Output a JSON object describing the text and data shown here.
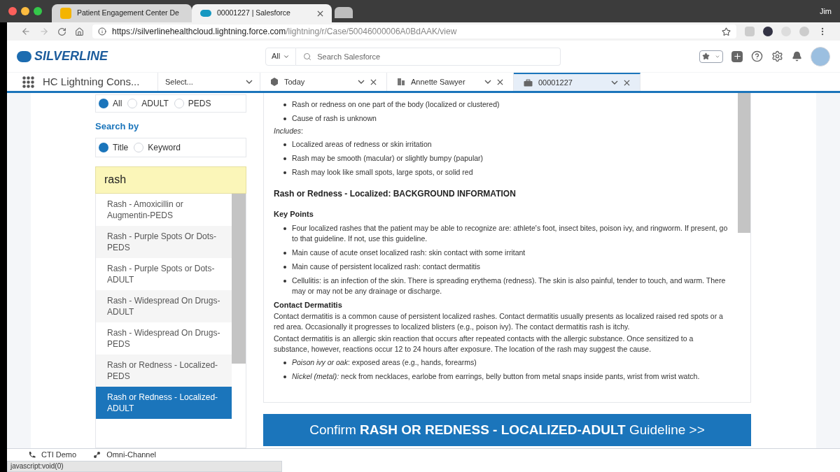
{
  "browser": {
    "tabs": [
      {
        "title": "Patient Engagement Center De",
        "kind": "doc",
        "selected": false
      },
      {
        "title": "00001227 | Salesforce",
        "kind": "cloud",
        "selected": true
      },
      {
        "kind": "new",
        "selected": false
      }
    ],
    "url_host": "https://silverlinehealthcloud.lightning.force.com",
    "url_path": "/lightning/r/Case/50046000006A0BdAAK/view",
    "user": "Jim"
  },
  "header": {
    "logo": "SILVERLINE",
    "search_scope": "All",
    "search_placeholder": "Search Salesforce"
  },
  "nav": {
    "app_name": "HC Lightning Cons...",
    "select_placeholder": "Select...",
    "tabs": [
      {
        "label": "Today",
        "kind": "hexagon",
        "selected": false
      },
      {
        "label": "Annette Sawyer",
        "kind": "building",
        "selected": false
      },
      {
        "label": "00001227",
        "kind": "briefcase",
        "selected": true
      }
    ]
  },
  "filters": {
    "population": [
      {
        "label": "All",
        "selected": true
      },
      {
        "label": "ADULT",
        "selected": false
      },
      {
        "label": "PEDS",
        "selected": false
      }
    ],
    "search_by_label": "Search by",
    "search_by": [
      {
        "label": "Title",
        "selected": true
      },
      {
        "label": "Keyword",
        "selected": false
      }
    ],
    "query": "rash",
    "results": [
      {
        "title": "Rash - Amoxicillin or Augmentin-PEDS",
        "selected": false
      },
      {
        "title": "Rash - Purple Spots Or Dots-PEDS",
        "selected": false
      },
      {
        "title": "Rash - Purple Spots or Dots-ADULT",
        "selected": false
      },
      {
        "title": "Rash - Widespread On Drugs-ADULT",
        "selected": false
      },
      {
        "title": "Rash - Widespread On Drugs-PEDS",
        "selected": false
      },
      {
        "title": "Rash or Redness - Localized-PEDS",
        "selected": false
      },
      {
        "title": "Rash or Redness - Localized-ADULT",
        "selected": true
      }
    ]
  },
  "article": [
    {
      "kind": "bullet",
      "text": "Rash or redness on one part of the body (localized or clustered)"
    },
    {
      "kind": "bullet",
      "text": "Cause of rash is unknown"
    },
    {
      "kind": "paragraph",
      "text": "*Includes*:"
    },
    {
      "kind": "bullet",
      "text": "Localized areas of redness or skin irritation"
    },
    {
      "kind": "bullet",
      "text": "Rash may be smooth (macular) or slightly bumpy (papular)"
    },
    {
      "kind": "bullet",
      "text": "Rash may look like small spots, large spots, or solid red"
    },
    {
      "kind": "heading",
      "text": "Rash or Redness - Localized: BACKGROUND INFORMATION"
    },
    {
      "kind": "subheading",
      "text": "Key Points"
    },
    {
      "kind": "bullet",
      "text": "Four localized rashes that the patient may be able to recognize are: athlete's foot, insect bites, poison ivy, and ringworm. If present, go to that guideline. If not, use this guideline."
    },
    {
      "kind": "bullet",
      "text": "Main cause of acute onset localized rash: skin contact with some irritant"
    },
    {
      "kind": "bullet",
      "text": "Main cause of persistent localized rash: contact dermatitis"
    },
    {
      "kind": "bullet",
      "text": "Cellulitis: is an infection of the skin. There is spreading erythema (redness). The skin is also painful, tender to touch, and warm. There may or may not be any drainage or discharge."
    },
    {
      "kind": "label",
      "text": "Contact Dermatitis"
    },
    {
      "kind": "paragraph",
      "text": "Contact dermatitis is a common cause of persistent localized rashes. Contact dermatitis usually presents as localized raised red spots or a red area. Occasionally it progresses to localized blisters (e.g., poison ivy). The contact dermatitis rash is itchy."
    },
    {
      "kind": "paragraph",
      "text": "Contact dermatitis is an allergic skin reaction that occurs after repeated contacts with the allergic substance. Once sensitized to a substance, however, reactions occur 12 to 24 hours after exposure. The location of the rash may suggest the cause."
    },
    {
      "kind": "bullet",
      "text": "*Poison ivy or oak*: exposed areas (e.g., hands, forearms)"
    },
    {
      "kind": "bullet",
      "text": "*Nickel (metal):* neck from necklaces, earlobe from earrings, belly button from metal snaps inside pants, wrist from wrist watch."
    }
  ],
  "confirm_button": "Confirm **RASH OR REDNESS - LOCALIZED-ADULT** Guideline >>",
  "utility_bar": [
    {
      "label": "CTI Demo",
      "kind": "phone"
    },
    {
      "label": "Omni-Channel",
      "kind": "channel"
    }
  ],
  "status_text": "javascript:void(0)"
}
